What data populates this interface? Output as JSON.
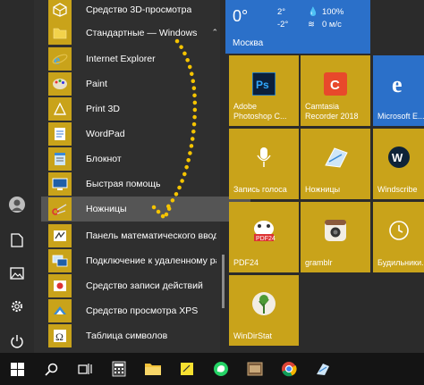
{
  "applist": {
    "top_item": "Средство 3D-просмотра",
    "folder": "Стандартные — Windows",
    "items": [
      "Internet Explorer",
      "Paint",
      "Print 3D",
      "WordPad",
      "Блокнот",
      "Быстрая помощь",
      "Ножницы",
      "Панель математического ввода",
      "Подключение к удаленному раб...",
      "Средство записи действий",
      "Средство просмотра XPS",
      "Таблица символов"
    ]
  },
  "weather": {
    "temp": "0°",
    "low": "-2°",
    "high": "2°",
    "humidity": "100%",
    "wind": "0 м/с",
    "city": "Москва"
  },
  "tiles": {
    "photoshop": "Adobe\nPhotoshop C...",
    "camtasia": "Camtasia\nRecorder 2018",
    "edge": "Microsoft E...",
    "voice": "Запись голоса",
    "snipping": "Ножницы",
    "windscribe": "Windscribe",
    "pdf24": "PDF24",
    "gramblr": "gramblr",
    "alarms": "Будильники...",
    "windirstat": "WinDirStat"
  },
  "colors": {
    "accent": "#c9a31a",
    "weather_blue": "#2b70c9",
    "taskbar": "#141414"
  }
}
